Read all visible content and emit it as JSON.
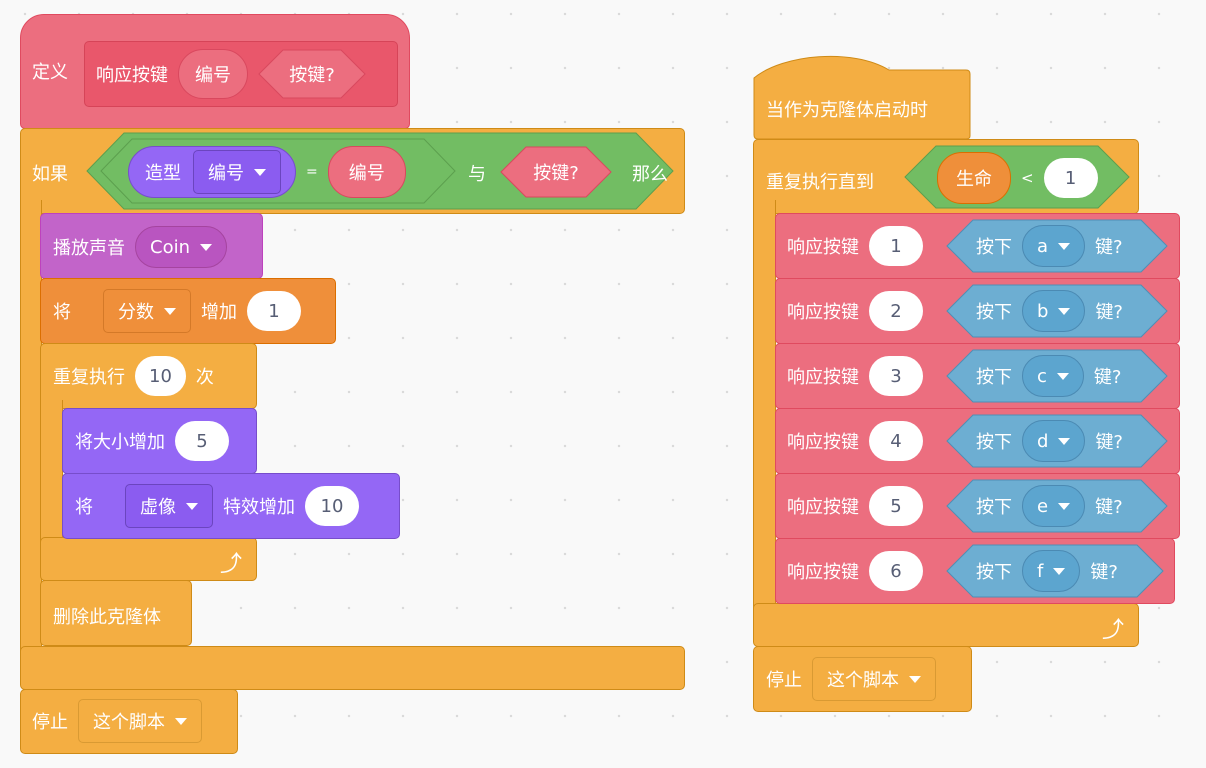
{
  "left_script": {
    "define": {
      "keyword": "定义",
      "proc_name": "响应按键",
      "param_number": "编号",
      "param_bool": "按键?"
    },
    "if_block": {
      "if_label": "如果",
      "then_label": "那么",
      "condition": {
        "costume_reporter": {
          "label": "造型",
          "dropdown": "编号"
        },
        "equals": "=",
        "right_param": "编号",
        "and_label": "与",
        "bool_param": "按键?"
      }
    },
    "play_sound": {
      "label": "播放声音",
      "sound": "Coin"
    },
    "change_var": {
      "label_pre": "将",
      "variable": "分数",
      "label_mid": "增加",
      "value": "1"
    },
    "repeat": {
      "label_pre": "重复执行",
      "times": "10",
      "label_post": "次"
    },
    "change_size": {
      "label": "将大小增加",
      "value": "5"
    },
    "change_effect": {
      "label_pre": "将",
      "effect": "虚像",
      "label_mid": "特效增加",
      "value": "10"
    },
    "delete_clone": {
      "label": "删除此克隆体"
    },
    "stop": {
      "label": "停止",
      "option": "这个脚本"
    }
  },
  "right_script": {
    "hat": {
      "label": "当作为克隆体启动时"
    },
    "repeat_until": {
      "label": "重复执行直到",
      "variable": "生命",
      "operator": "<",
      "value": "1"
    },
    "calls": [
      {
        "label": "响应按键",
        "number": "1",
        "pressed_pre": "按下",
        "key": "a",
        "pressed_post": "键?"
      },
      {
        "label": "响应按键",
        "number": "2",
        "pressed_pre": "按下",
        "key": "b",
        "pressed_post": "键?"
      },
      {
        "label": "响应按键",
        "number": "3",
        "pressed_pre": "按下",
        "key": "c",
        "pressed_post": "键?"
      },
      {
        "label": "响应按键",
        "number": "4",
        "pressed_pre": "按下",
        "key": "d",
        "pressed_post": "键?"
      },
      {
        "label": "响应按键",
        "number": "5",
        "pressed_pre": "按下",
        "key": "e",
        "pressed_post": "键?"
      },
      {
        "label": "响应按键",
        "number": "6",
        "pressed_pre": "按下",
        "key": "f",
        "pressed_post": "键?"
      }
    ],
    "stop": {
      "label": "停止",
      "option": "这个脚本"
    }
  },
  "colors": {
    "control": "#f4ae42",
    "looks": "#9467f5",
    "sound": "#c264c9",
    "variables": "#ef8f3a",
    "my_blocks": "#ec6e7f",
    "operators": "#72bd63",
    "sensing": "#6daed2"
  }
}
